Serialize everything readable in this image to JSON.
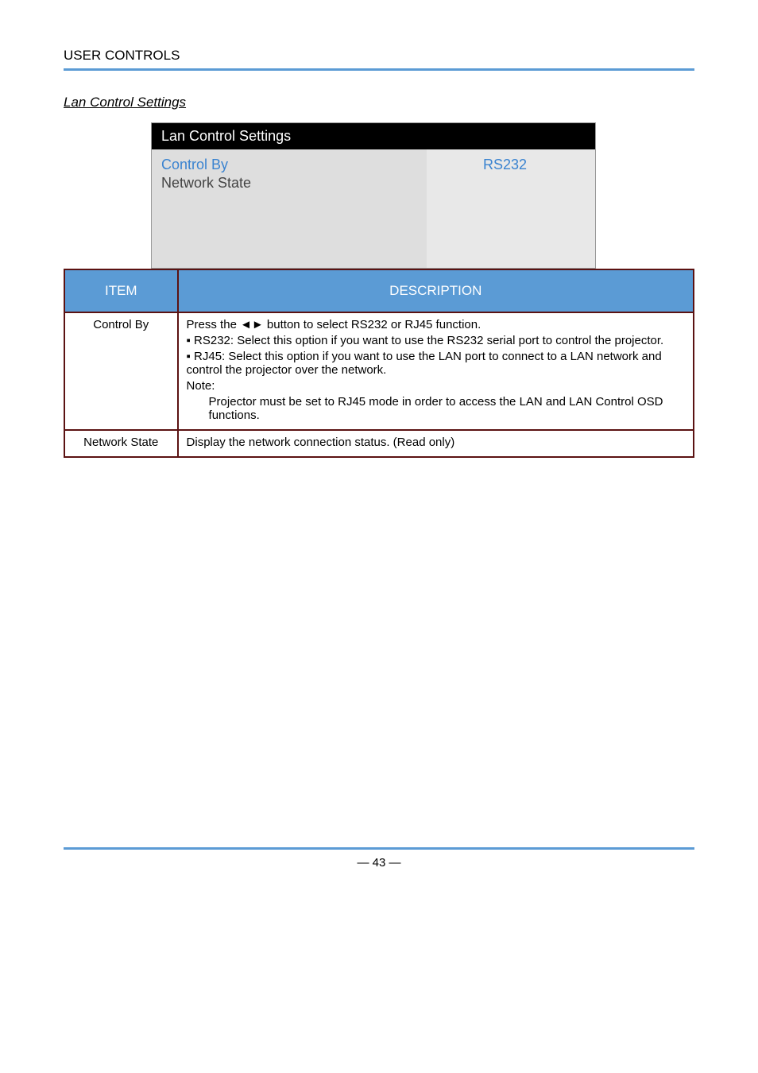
{
  "header": {
    "category": "USER CONTROLS"
  },
  "section": {
    "title": "Lan Control Settings"
  },
  "osd": {
    "title": "Lan Control Settings",
    "rows": [
      {
        "label": "Control By",
        "value": "RS232",
        "highlighted": true
      },
      {
        "label": "Network State",
        "value": "",
        "highlighted": false
      }
    ]
  },
  "table": {
    "headers": {
      "item": "ITEM",
      "description": "DESCRIPTION"
    },
    "rows": [
      {
        "item": "Control By",
        "description": [
          {
            "text": "Press the ◄► button to select RS232 or RJ45 function.",
            "indent": false
          },
          {
            "text": "▪ RS232: Select this option if you want to use the RS232 serial port to control the projector.",
            "indent": false
          },
          {
            "text": "▪ RJ45: Select this option if you want to use the LAN port to connect to a LAN network and control the projector over the network.",
            "indent": false
          },
          {
            "text": "Note:",
            "indent": false
          },
          {
            "text": "Projector must be set to RJ45 mode in order to access the LAN and LAN Control OSD functions.",
            "indent": true
          }
        ]
      },
      {
        "item": "Network State",
        "description": [
          {
            "text": "Display the network connection status. (Read only)",
            "indent": false
          }
        ]
      }
    ]
  },
  "footer": {
    "page": "— 43 —"
  }
}
